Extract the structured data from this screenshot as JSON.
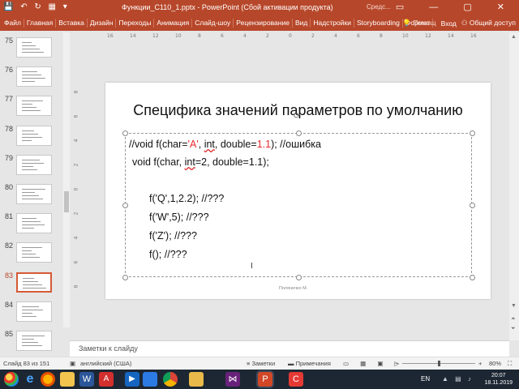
{
  "window": {
    "document_title": "Функции_С110_1.pptx - PowerPoint (Сбой активации продукта)",
    "context_label": "Средс...",
    "quick_access": "💾 ↶ ↻ ▦ ▾",
    "controls": "▭ — ▢ ✕"
  },
  "ribbon": {
    "tabs": [
      "Файл",
      "Главная",
      "Вставка",
      "Дизайн",
      "Переходы",
      "Анимация",
      "Слайд-шоу",
      "Рецензирование",
      "Вид",
      "Надстройки",
      "Storyboarding",
      "Формат"
    ],
    "tell_me": "Помощ",
    "signin": "Вход",
    "share": "Общий доступ"
  },
  "thumbnails": [
    {
      "num": "75",
      "active": false
    },
    {
      "num": "76",
      "active": false
    },
    {
      "num": "77",
      "active": false
    },
    {
      "num": "78",
      "active": false
    },
    {
      "num": "79",
      "active": false
    },
    {
      "num": "80",
      "active": false
    },
    {
      "num": "81",
      "active": false
    },
    {
      "num": "82",
      "active": false
    },
    {
      "num": "83",
      "active": true
    },
    {
      "num": "84",
      "active": false
    },
    {
      "num": "85",
      "active": false
    }
  ],
  "slide": {
    "title": "Специфика значений параметров по умолчанию",
    "line1": {
      "p1": "//void f(char=",
      "p2": "'A'",
      "p3": ", ",
      "p4": "int",
      "p5": ", double=",
      "p6": "1.1",
      "p7": "); //ошибка"
    },
    "line2": {
      "p1": "void f(char, ",
      "p2": "int",
      "p3": "=2, double=1.1);"
    },
    "calls": [
      "f('Q',1,2.2); //???",
      "f('W',5); //???",
      "f('Z'); //???",
      "f(); //???"
    ],
    "footer": "Поляничко М."
  },
  "notes_placeholder": "Заметки к слайду",
  "status": {
    "slide_counter": "Слайд 83 из 151",
    "language": "английский (США)",
    "notes_btn": "Заметки",
    "comments_btn": "Примечания",
    "zoom": "80%"
  },
  "taskbar": {
    "lang": "EN",
    "time": "20:07",
    "date": "18.11.2019"
  },
  "colors": {
    "accent": "#b7472a",
    "code_red": "#e8292a"
  }
}
